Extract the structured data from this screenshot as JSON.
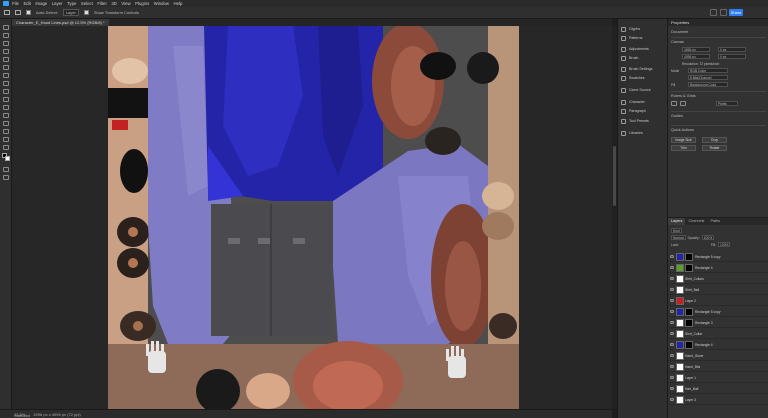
{
  "menubar": {
    "items": [
      "File",
      "Edit",
      "Image",
      "Layer",
      "Type",
      "Select",
      "Filter",
      "3D",
      "View",
      "Plugins",
      "Window",
      "Help"
    ]
  },
  "options": {
    "auto_select": "Auto-Select:",
    "layer_select": "Layer",
    "show_transform": "Show Transform Controls",
    "share": "Share"
  },
  "document": {
    "tab_title": "Character_E_Hood Lines.psd @ 12.5% (RGB/8) *"
  },
  "status": {
    "zoom": "12.5%",
    "size": "4096 px x 4096 px (72 ppi)",
    "mode": "Standard"
  },
  "dock": {
    "items": [
      "Glyphs",
      "Patterns",
      "Adjustments",
      "Brush",
      "Brush Settings",
      "Swatches",
      "Clone Source",
      "Character",
      "Paragraph",
      "Tool Presets",
      "Libraries"
    ]
  },
  "properties": {
    "title": "Properties",
    "doc_label": "Document",
    "canvas_title": "Canvas",
    "w_value": "4096 px",
    "h_value": "4096 px",
    "x_value": "0 px",
    "y_value": "0 px",
    "resolution": "Resolution: 72 pixels/inch",
    "mode_label": "Mode",
    "mode_value": "RGB Color",
    "depth_value": "8 Bits/Channel",
    "fill_label": "Fill",
    "fill_value": "Background Color",
    "rulers_title": "Rulers & Grids",
    "rulers_units": "Pixels",
    "guides_title": "Guides",
    "quick_actions_title": "Quick Actions",
    "qa_btn1": "Image Size",
    "qa_btn2": "Crop",
    "qa_btn3": "Trim",
    "qa_btn4": "Rotate"
  },
  "layers": {
    "tabs": [
      "Layers",
      "Channels",
      "Paths"
    ],
    "kind": "Kind",
    "blend_mode": "Normal",
    "opacity_label": "Opacity:",
    "opacity": "100%",
    "lock_label": "Lock:",
    "fill_label": "Fill:",
    "fill": "100%",
    "rows": [
      {
        "name": "Rectangle 5 copy"
      },
      {
        "name": "Rectangle 4"
      },
      {
        "name": "Shirt_Collars"
      },
      {
        "name": "Shirt_Ball"
      },
      {
        "name": "Layer 2"
      },
      {
        "name": "Rectangle 5 copy"
      },
      {
        "name": "Rectangle 3"
      },
      {
        "name": "Shirt_Collar"
      },
      {
        "name": "Rectangle 4"
      },
      {
        "name": "Hand_Glove"
      },
      {
        "name": "Hand_Bits"
      },
      {
        "name": "Layer 1"
      },
      {
        "name": "Hair_Ball"
      },
      {
        "name": "Layer 3"
      }
    ]
  },
  "colors": {
    "accent": "#2f7cf6",
    "purple_fabric": "#7f7bc4",
    "blue_shirt": "#2424a8",
    "grey_pants": "#4b4b4f",
    "skin": "#d9a889",
    "hair_red": "#8b4a3a"
  }
}
